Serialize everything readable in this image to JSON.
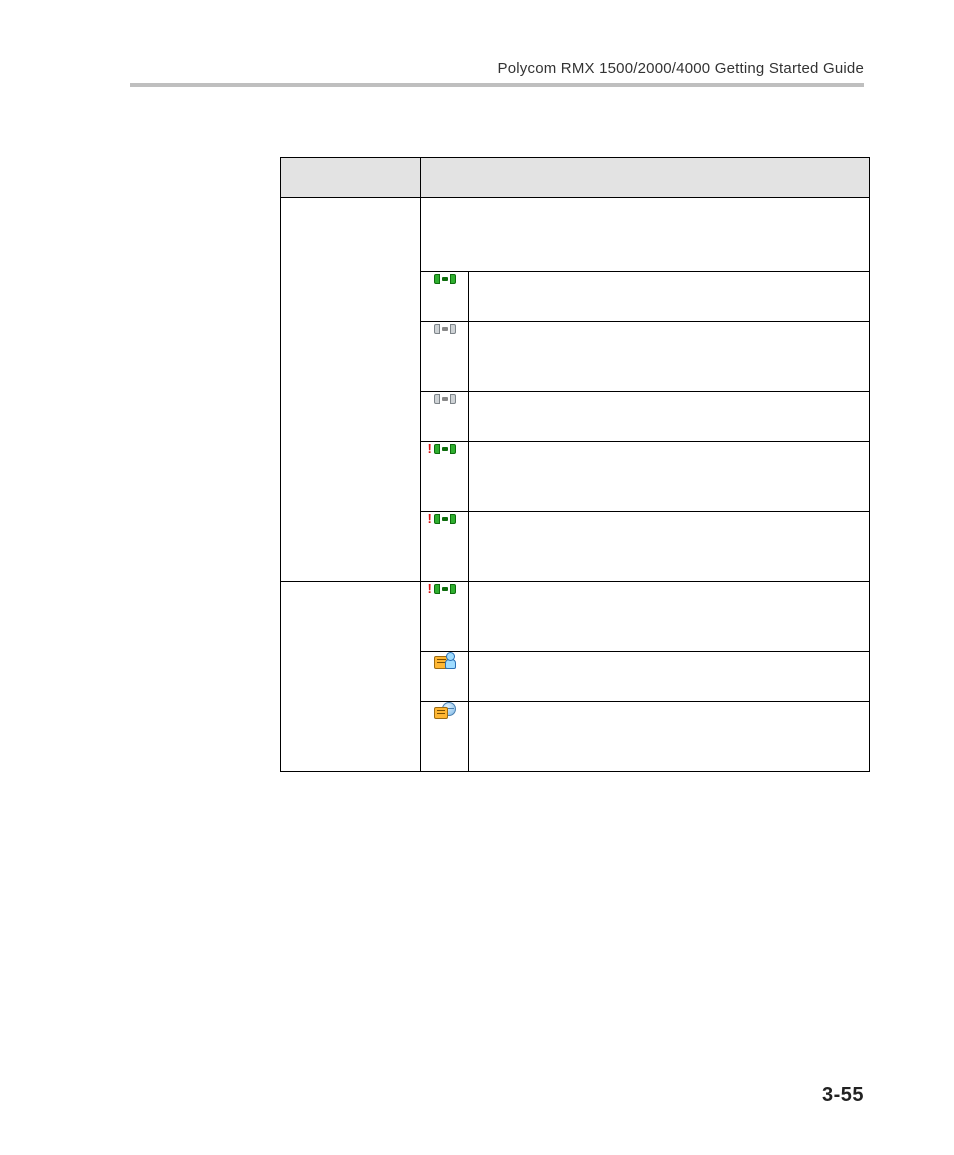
{
  "header": {
    "running_title": "Polycom RMX 1500/2000/4000 Getting Started Guide"
  },
  "page_number": "3-55",
  "icons": {
    "pair_green": "connected-green-icon",
    "pair_gray_1": "disconnected-gray-icon",
    "pair_gray_2": "disconnected-gray-icon",
    "alert_green_1": "faulty-connected-icon",
    "alert_green_2": "faulty-connected-icon",
    "alert_green_3": "faulty-connected-icon",
    "note_person": "note-participant-icon",
    "note_globe": "note-conference-icon"
  }
}
